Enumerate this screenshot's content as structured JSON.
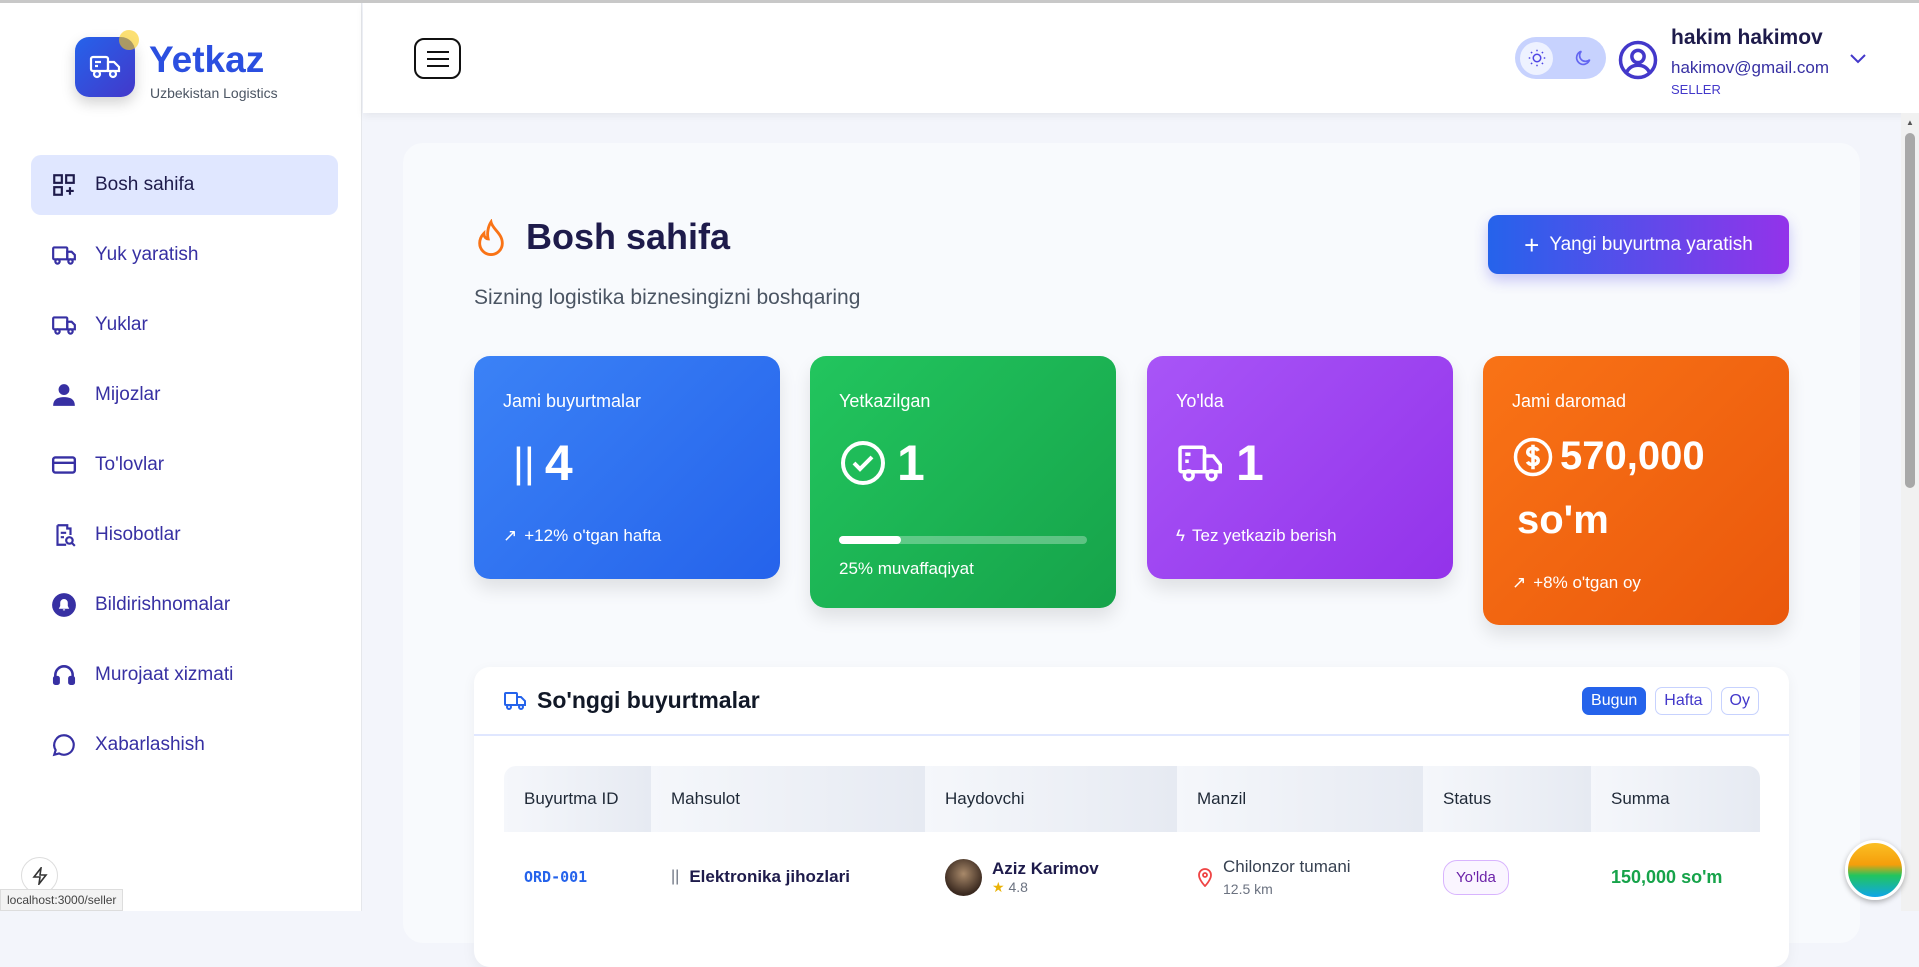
{
  "brand": {
    "name": "Yetkaz",
    "tagline": "Uzbekistan Logistics"
  },
  "sidebar": {
    "items": [
      {
        "label": "Bosh sahifa",
        "icon": "dashboard-icon",
        "active": true
      },
      {
        "label": "Yuk yaratish",
        "icon": "truck-icon"
      },
      {
        "label": "Yuklar",
        "icon": "truck-icon"
      },
      {
        "label": "Mijozlar",
        "icon": "user-icon"
      },
      {
        "label": "To'lovlar",
        "icon": "credit-card-icon"
      },
      {
        "label": "Hisobotlar",
        "icon": "report-icon"
      },
      {
        "label": "Bildirishnomalar",
        "icon": "bell-icon"
      },
      {
        "label": "Murojaat xizmati",
        "icon": "headset-icon"
      },
      {
        "label": "Xabarlashish",
        "icon": "chat-icon"
      }
    ]
  },
  "header": {
    "user": {
      "name": "hakim hakimov",
      "email": "hakimov@gmail.com",
      "role": "SELLER"
    }
  },
  "page": {
    "title": "Bosh sahifa",
    "subtitle": "Sizning logistika biznesingizni boshqaring",
    "new_order_label": "Yangi buyurtma yaratish"
  },
  "stats": [
    {
      "label": "Jami buyurtmalar",
      "value": "4",
      "prefix": "||",
      "footer": "+12% o'tgan hafta",
      "color": "#3b82f6"
    },
    {
      "label": "Yetkazilgan",
      "value": "1",
      "footer": "25% muvaffaqiyat",
      "progress": 0.25,
      "color": "#22c55e"
    },
    {
      "label": "Yo'lda",
      "value": "1",
      "footer": "Tez yetkazib berish",
      "color": "#a855f7"
    },
    {
      "label": "Jami daromad",
      "value": "570,000",
      "value2": "so'm",
      "footer": "+8% o'tgan oy",
      "color": "#f97316"
    }
  ],
  "orders": {
    "title": "So'nggi buyurtmalar",
    "filters": [
      "Bugun",
      "Hafta",
      "Oy"
    ],
    "columns": [
      "Buyurtma ID",
      "Mahsulot",
      "Haydovchi",
      "Manzil",
      "Status",
      "Summa"
    ],
    "rows": [
      {
        "id": "ORD-001",
        "product_prefix": "||",
        "product": "Elektronika jihozlari",
        "driver": "Aziz Karimov",
        "rating": "4.8",
        "address": "Chilonzor tumani",
        "distance": "12.5 km",
        "status": "Yo'lda",
        "sum": "150,000 so'm"
      }
    ]
  },
  "status_url": "localhost:3000/seller"
}
